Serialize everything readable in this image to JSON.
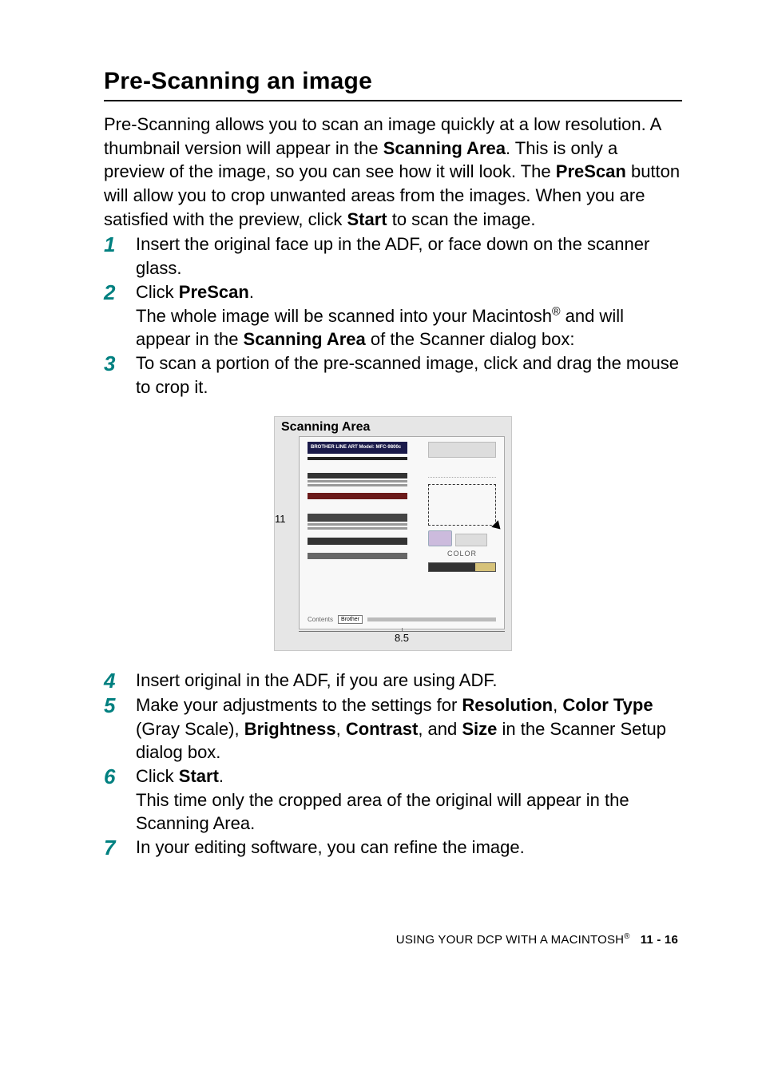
{
  "title": "Pre-Scanning an image",
  "intro": {
    "p1a": "Pre-Scanning allows you to scan an image quickly at a low resolution. A thumbnail version will appear in the ",
    "p1b": "Scanning Area",
    "p1c": ". This is only a preview of the image, so you can see how it will look. The ",
    "p1d": "PreScan",
    "p1e": " button will allow you to crop unwanted areas from the images. When you are satisfied with the preview, click ",
    "p1f": "Start",
    "p1g": " to scan the image."
  },
  "steps": {
    "s1": "Insert the original face up in the ADF, or face down on the scanner glass.",
    "s2a": "Click ",
    "s2b": "PreScan",
    "s2c": ".",
    "s2d": "The whole image will be scanned into your Macintosh",
    "s2e": "®",
    "s2f": " and will appear in the ",
    "s2g": "Scanning Area",
    "s2h": " of the Scanner dialog box:",
    "s3": "To scan a portion of the pre-scanned image, click and drag the mouse to crop it.",
    "s4": "Insert original in the ADF, if you are using ADF.",
    "s5a": "Make your adjustments to the settings for ",
    "s5b": "Resolution",
    "s5c": ", ",
    "s5d": "Color Type",
    "s5e": " (Gray Scale), ",
    "s5f": "Brightness",
    "s5g": ", ",
    "s5h": "Contrast",
    "s5i": ", and ",
    "s5j": "Size",
    "s5k": " in the Scanner Setup dialog box.",
    "s6a": "Click ",
    "s6b": "Start",
    "s6c": ".",
    "s6d": "This time only the cropped area of the original will appear in the Scanning Area.",
    "s7": "In your editing software, you can refine the image."
  },
  "nums": {
    "n1": "1",
    "n2": "2",
    "n3": "3",
    "n4": "4",
    "n5": "5",
    "n6": "6",
    "n7": "7"
  },
  "figure": {
    "title": "Scanning Area",
    "y_label": "11",
    "x_label": "8.5",
    "doc_heading": "BROTHER LINE ART\nModel: MFC-9800c",
    "color_label": "COLOR",
    "contents_label": "Contents",
    "contents_value": "Brother"
  },
  "footer": {
    "text_a": "USING YOUR DCP WITH A MACINTOSH",
    "text_b": "®",
    "page": "11 - 16"
  }
}
